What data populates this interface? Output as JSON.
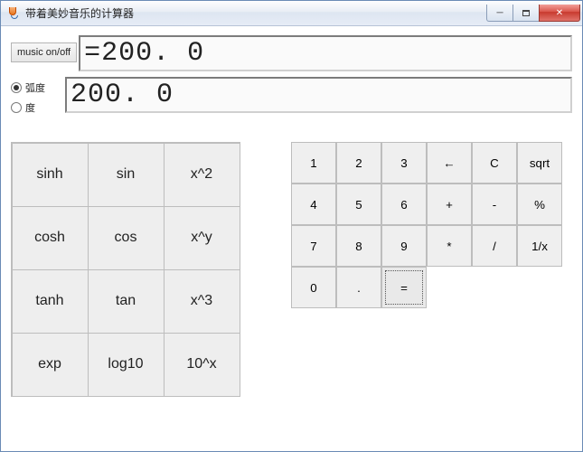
{
  "window": {
    "title": "带着美妙音乐的计算器"
  },
  "controls": {
    "music_button": "music on/off",
    "radio_radian": "弧度",
    "radio_degree": "度"
  },
  "display": {
    "expression": "=200. 0",
    "result": "200. 0"
  },
  "sci_buttons": [
    "sinh",
    "sin",
    "x^2",
    "cosh",
    "cos",
    "x^y",
    "tanh",
    "tan",
    "x^3",
    "exp",
    "log10",
    "10^x"
  ],
  "num_buttons": [
    "1",
    "2",
    "3",
    "←",
    "C",
    "sqrt",
    "4",
    "5",
    "6",
    "+",
    "-",
    "%",
    "7",
    "8",
    "9",
    "*",
    "/",
    "1/x",
    "0",
    ".",
    "="
  ]
}
